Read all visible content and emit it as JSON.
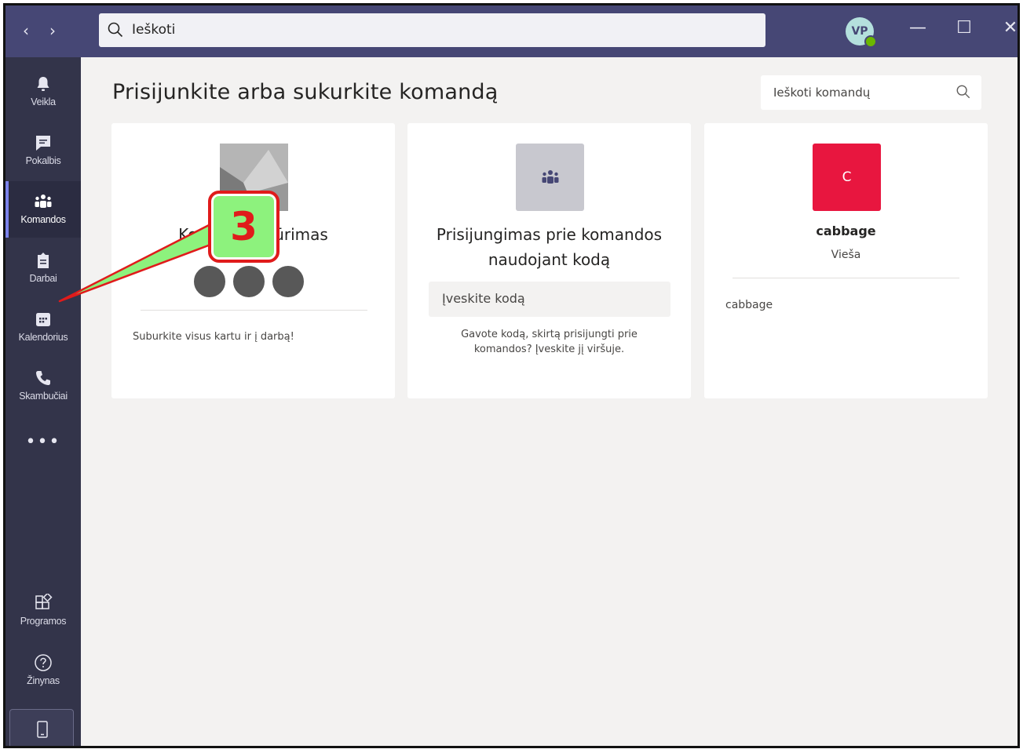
{
  "titlebar": {
    "nav_back": "‹",
    "nav_forward": "›",
    "search_placeholder": "Ieškoti",
    "avatar_initials": "VP",
    "status_color": "#6bb700",
    "minimize": "—",
    "maximize": "☐",
    "close": "✕"
  },
  "sidebar": {
    "items": [
      {
        "label": "Veikla",
        "icon": "bell-icon"
      },
      {
        "label": "Pokalbis",
        "icon": "chat-icon"
      },
      {
        "label": "Komandos",
        "icon": "teams-icon",
        "active": true
      },
      {
        "label": "Darbai",
        "icon": "assignments-icon"
      },
      {
        "label": "Kalendorius",
        "icon": "calendar-icon"
      },
      {
        "label": "Skambučiai",
        "icon": "phone-icon"
      }
    ],
    "more": "•••",
    "bottom_items": [
      {
        "label": "Programos",
        "icon": "apps-icon"
      },
      {
        "label": "Žinynas",
        "icon": "help-icon"
      }
    ]
  },
  "main": {
    "title": "Prisijunkite arba sukurkite komandą",
    "team_search_placeholder": "Ieškoti komandų",
    "create_card": {
      "title": "Komandos kūrimas",
      "description": "Suburkite visus kartu ir į darbą!"
    },
    "join_card": {
      "title_line1": "Prisijungimas prie komandos",
      "title_line2": "naudojant kodą",
      "code_placeholder": "Įveskite kodą",
      "description_line1": "Gavote kodą, skirtą prisijungti prie",
      "description_line2": "komandos? Įveskite jį viršuje."
    },
    "team_card": {
      "tile_letter": "C",
      "tile_color": "#e8163f",
      "name": "cabbage",
      "type": "Vieša",
      "description": "cabbage"
    }
  },
  "annotation": {
    "step_number": "3",
    "color": "#e01b1b",
    "fill": "#8df27d"
  }
}
